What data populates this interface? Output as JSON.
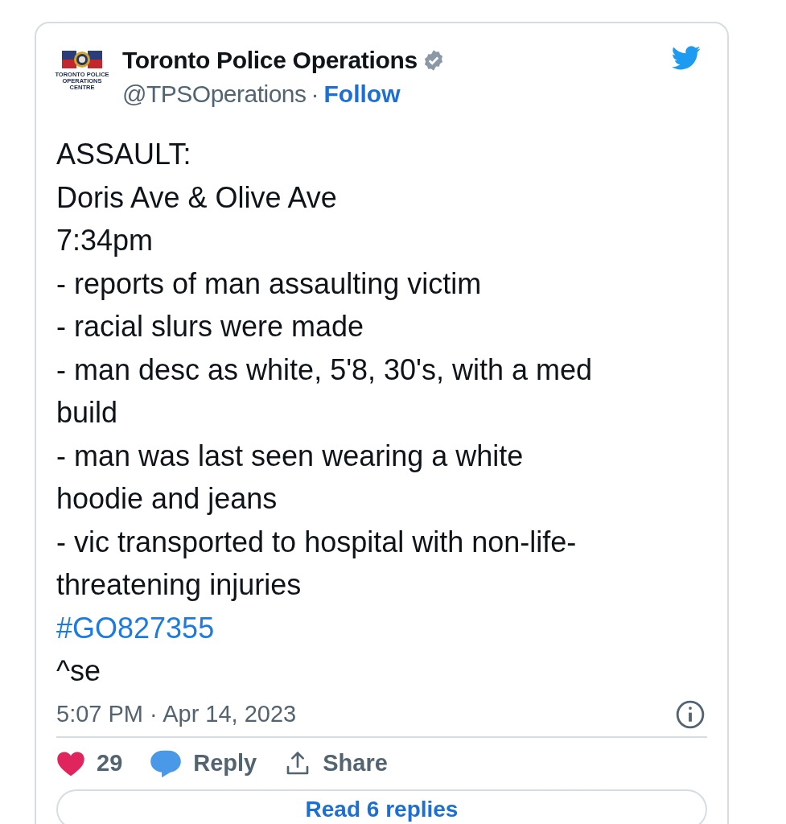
{
  "author": {
    "name": "Toronto Police Operations",
    "verified": true,
    "handle": "@TPSOperations",
    "separator": "·",
    "follow": "Follow",
    "logo_caption": [
      "TORONTO POLICE",
      "OPERATIONS",
      "CENTRE"
    ]
  },
  "body": [
    {
      "kind": "text",
      "text": "ASSAULT:"
    },
    {
      "kind": "text",
      "text": "Doris Ave & Olive Ave"
    },
    {
      "kind": "text",
      "text": "7:34pm"
    },
    {
      "kind": "text",
      "text": "- reports of man assaulting victim"
    },
    {
      "kind": "text",
      "text": "- racial slurs were made"
    },
    {
      "kind": "text",
      "text": "- man desc as white, 5'8, 30's, with a med"
    },
    {
      "kind": "text",
      "text": "build"
    },
    {
      "kind": "text",
      "text": "- man was last seen wearing a white"
    },
    {
      "kind": "text",
      "text": "hoodie and jeans"
    },
    {
      "kind": "text",
      "text": "- vic transported to hospital with non-life-"
    },
    {
      "kind": "text",
      "text": "threatening injuries"
    },
    {
      "kind": "hashtag",
      "text": "#GO827355"
    },
    {
      "kind": "text",
      "text": "^se"
    }
  ],
  "timestamp": "5:07 PM · Apr 14, 2023",
  "actions": [
    {
      "kind": "like",
      "label": "29"
    },
    {
      "kind": "reply",
      "label": "Reply"
    },
    {
      "kind": "share",
      "label": "Share"
    }
  ],
  "read_replies": "Read 6 replies"
}
